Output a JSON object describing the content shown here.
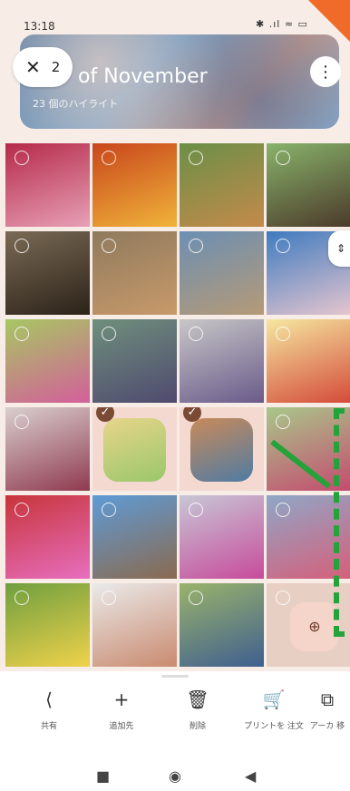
{
  "status": {
    "time": "13:18",
    "icons": "✱ .ıl ≈ ▭"
  },
  "banner": {
    "title": "of November",
    "subtitle": "23 個のハイライト"
  },
  "selection": {
    "close": "✕",
    "count": "2"
  },
  "more": "⋮",
  "scroll_handle": "⇕",
  "zoom": "⊕",
  "grid": {
    "tiles": [
      {
        "a": "#b52a4a",
        "b": "#e7a0b6",
        "sel": false
      },
      {
        "a": "#c8461c",
        "b": "#f0b33a",
        "sel": false
      },
      {
        "a": "#6b8f47",
        "b": "#c48a4b",
        "sel": false
      },
      {
        "a": "#89b36b",
        "b": "#4b3a2a",
        "sel": false
      },
      {
        "a": "#7a6a55",
        "b": "#2b2218",
        "sel": false
      },
      {
        "a": "#8f7a5e",
        "b": "#c89a6a",
        "sel": false
      },
      {
        "a": "#6c8fb3",
        "b": "#b59a77",
        "sel": false
      },
      {
        "a": "#3f7bbf",
        "b": "#e5c5cf",
        "sel": false
      },
      {
        "a": "#a7c763",
        "b": "#d35f9a",
        "sel": false
      },
      {
        "a": "#6f8f7c",
        "b": "#4f4a6f",
        "sel": false
      },
      {
        "a": "#c7c7c7",
        "b": "#6a5a8a",
        "sel": false
      },
      {
        "a": "#f5e7a0",
        "b": "#d44b3a",
        "sel": false
      },
      {
        "a": "#d9cfcf",
        "b": "#8f3a4f",
        "sel": false
      },
      {
        "a": "#e7d58a",
        "b": "#9ac76b",
        "sel": true
      },
      {
        "a": "#c98a5a",
        "b": "#4f7ba3",
        "sel": true
      },
      {
        "a": "#a9c78b",
        "b": "#c44b6f",
        "sel": false
      },
      {
        "a": "#c7343a",
        "b": "#e76fbf",
        "sel": false
      },
      {
        "a": "#5f9bd6",
        "b": "#8a6a4f",
        "sel": false
      },
      {
        "a": "#c7c7d6",
        "b": "#c74b9b",
        "sel": false
      },
      {
        "a": "#8fa7c7",
        "b": "#d65f7a",
        "sel": false
      },
      {
        "a": "#6f9f3f",
        "b": "#f0d24b",
        "sel": false
      },
      {
        "a": "#eaeaea",
        "b": "#c98a6f",
        "sel": false
      },
      {
        "a": "#9ab36b",
        "b": "#3f5f8f",
        "sel": false
      },
      {
        "a": "#e8cfc4",
        "b": "#e8cfc4",
        "sel": false
      }
    ]
  },
  "actions": [
    {
      "icon": "⟨",
      "label": "共有"
    },
    {
      "icon": "+",
      "label": "追加先"
    },
    {
      "icon": "🗑",
      "label": "削除"
    },
    {
      "icon": "🛒",
      "label": "プリントを 注文"
    },
    {
      "icon": "⧉",
      "label": "アーカ 移"
    }
  ],
  "nav": {
    "recent": "■",
    "home": "◉",
    "back": "◀"
  },
  "colors": {
    "accent": "#7a4a35",
    "annotation": "#23a33a",
    "corner": "#f06a2a"
  }
}
